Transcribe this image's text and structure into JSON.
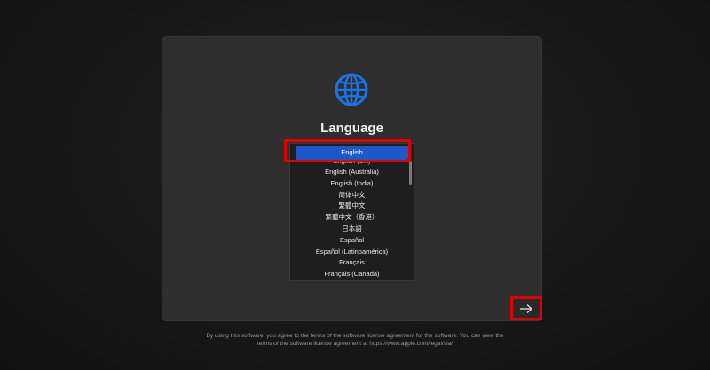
{
  "window": {
    "title": "Language"
  },
  "languages": {
    "selected": "English",
    "items": [
      "English (UK)",
      "English (Australia)",
      "English (India)",
      "简体中文",
      "繁體中文",
      "繁體中文（香港）",
      "日本語",
      "Español",
      "Español (Latinoamérica)",
      "Français",
      "Français (Canada)"
    ]
  },
  "continue": {
    "icon": "arrow-right-icon"
  },
  "footer": {
    "line1": "By using this software, you agree to the terms of the software license agreement for the software. You can view the",
    "line2": "terms of the software license agreement at https://www.apple.com/legal/sla/"
  },
  "colors": {
    "accent": "#1c58c7",
    "highlight": "#e00000",
    "globe": "#1a73e8"
  }
}
